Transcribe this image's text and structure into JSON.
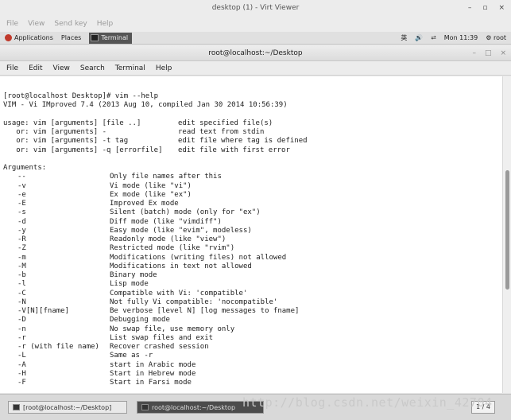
{
  "window": {
    "title": "desktop (1) - Virt Viewer",
    "controls": [
      "–",
      "▫",
      "×"
    ],
    "menu": [
      "File",
      "View",
      "Send key",
      "Help"
    ]
  },
  "guest_top_panel": {
    "applications": "Applications",
    "places": "Places",
    "active_app": "Terminal",
    "input_method": "英",
    "clock": "Mon 11:39",
    "user": "root"
  },
  "terminal": {
    "title": "root@localhost:~/Desktop",
    "window_buttons": [
      "–",
      "□",
      "×"
    ],
    "menu": [
      "File",
      "Edit",
      "View",
      "Search",
      "Terminal",
      "Help"
    ],
    "prompt_line": "[root@localhost Desktop]# vim --help",
    "version_line": "VIM - Vi IMproved 7.4 (2013 Aug 10, compiled Jan 30 2014 10:56:39)",
    "usage": [
      {
        "cmd": "usage: vim [arguments] [file ..]",
        "desc": "edit specified file(s)"
      },
      {
        "cmd": "   or: vim [arguments] -",
        "desc": "read text from stdin"
      },
      {
        "cmd": "   or: vim [arguments] -t tag",
        "desc": "edit file where tag is defined"
      },
      {
        "cmd": "   or: vim [arguments] -q [errorfile]",
        "desc": "edit file with first error"
      }
    ],
    "arguments_header": "Arguments:",
    "arguments": [
      {
        "flag": "--",
        "desc": "Only file names after this"
      },
      {
        "flag": "-v",
        "desc": "Vi mode (like \"vi\")"
      },
      {
        "flag": "-e",
        "desc": "Ex mode (like \"ex\")"
      },
      {
        "flag": "-E",
        "desc": "Improved Ex mode"
      },
      {
        "flag": "-s",
        "desc": "Silent (batch) mode (only for \"ex\")"
      },
      {
        "flag": "-d",
        "desc": "Diff mode (like \"vimdiff\")"
      },
      {
        "flag": "-y",
        "desc": "Easy mode (like \"evim\", modeless)"
      },
      {
        "flag": "-R",
        "desc": "Readonly mode (like \"view\")"
      },
      {
        "flag": "-Z",
        "desc": "Restricted mode (like \"rvim\")"
      },
      {
        "flag": "-m",
        "desc": "Modifications (writing files) not allowed"
      },
      {
        "flag": "-M",
        "desc": "Modifications in text not allowed"
      },
      {
        "flag": "-b",
        "desc": "Binary mode"
      },
      {
        "flag": "-l",
        "desc": "Lisp mode"
      },
      {
        "flag": "-C",
        "desc": "Compatible with Vi: 'compatible'"
      },
      {
        "flag": "-N",
        "desc": "Not fully Vi compatible: 'nocompatible'"
      },
      {
        "flag": "-V[N][fname]",
        "desc": "Be verbose [level N] [log messages to fname]"
      },
      {
        "flag": "-D",
        "desc": "Debugging mode"
      },
      {
        "flag": "-n",
        "desc": "No swap file, use memory only"
      },
      {
        "flag": "-r",
        "desc": "List swap files and exit"
      },
      {
        "flag": "-r (with file name)",
        "desc": "Recover crashed session"
      },
      {
        "flag": "-L",
        "desc": "Same as -r"
      },
      {
        "flag": "-A",
        "desc": "start in Arabic mode"
      },
      {
        "flag": "-H",
        "desc": "Start in Hebrew mode"
      },
      {
        "flag": "-F",
        "desc": "Start in Farsi mode"
      }
    ]
  },
  "taskbar": {
    "items": [
      "[root@localhost:~/Desktop]",
      "root@localhost:~/Desktop"
    ],
    "pager": "1 / 4",
    "watermark": "http://blog.csdn.net/weixin_42704"
  }
}
